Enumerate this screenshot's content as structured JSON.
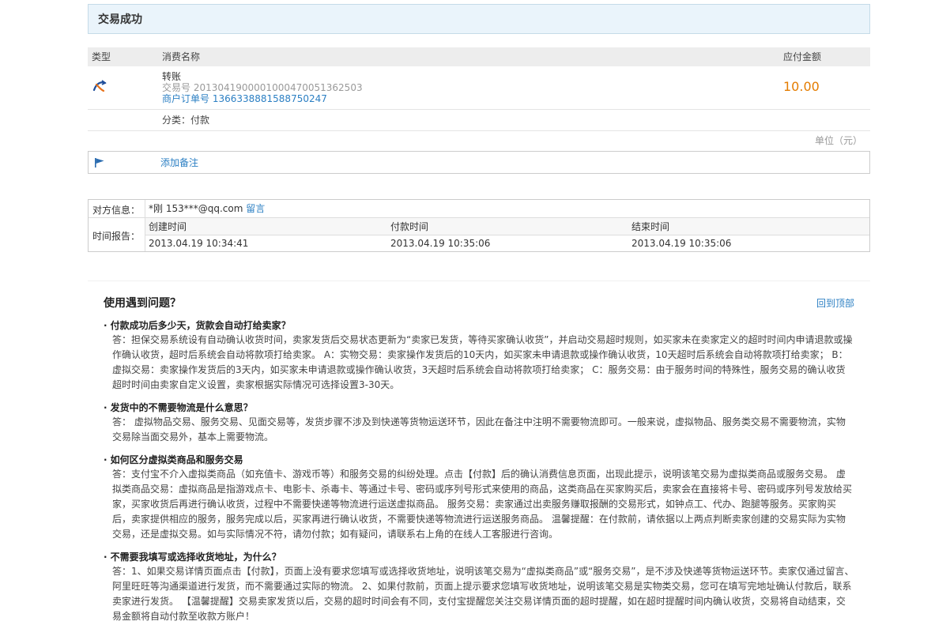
{
  "status": {
    "title": "交易成功"
  },
  "order_table": {
    "headers": {
      "type": "类型",
      "name": "消费名称",
      "amount": "应付金额"
    },
    "row": {
      "icon": "transfer-icon",
      "item_name": "转账",
      "trade_no": "交易号 2013041900001000470051362503",
      "merchant_no": "商户订单号 1366338881588750247",
      "amount": "10.00"
    },
    "category": "分类：付款",
    "unit": "单位（元）"
  },
  "note": {
    "icon": "flag-icon",
    "label": "添加备注"
  },
  "info": {
    "counterparty_label": "对方信息：",
    "counterparty_value": "*刚 153***@qq.com",
    "message_link": "留言",
    "time_label": "时间报告：",
    "time_headers": [
      "创建时间",
      "付款时间",
      "结束时间"
    ],
    "time_values": [
      "2013.04.19 10:34:41",
      "2013.04.19 10:35:06",
      "2013.04.19 10:35:06"
    ]
  },
  "faq": {
    "title": "使用遇到问题？",
    "back_to_top": "回到顶部",
    "items": [
      {
        "q": "付款成功后多少天，货款会自动打给卖家？",
        "a": "答：担保交易系统设有自动确认收货时间，卖家发货后交易状态更新为“卖家已发货，等待买家确认收货”，并启动交易超时规则，如买家未在卖家定义的超时时间内申请退款或操作确认收货，超时后系统会自动将款项打给卖家。 A：实物交易：卖家操作发货后的10天内，如买家未申请退款或操作确认收货，10天超时后系统会自动将款项打给卖家； B：虚拟交易：卖家操作发货后的3天内，如买家未申请退款或操作确认收货，3天超时后系统会自动将款项打给卖家； C：服务交易：由于服务时间的特殊性，服务交易的确认收货超时时间由卖家自定义设置，卖家根据实际情况可选择设置3-30天。"
      },
      {
        "q": "发货中的不需要物流是什么意思？",
        "a": "答： 虚拟物品交易、服务交易、见面交易等，发货步骤不涉及到快递等货物运送环节，因此在备注中注明不需要物流即可。一般来说，虚拟物品、服务类交易不需要物流，实物交易除当面交易外，基本上需要物流。"
      },
      {
        "q": "如何区分虚拟类商品和服务交易",
        "a": "答：支付宝不介入虚拟类商品（如充值卡、游戏币等）和服务交易的纠纷处理。点击【付款】后的确认消费信息页面，出现此提示，说明该笔交易为虚拟类商品或服务交易。 虚拟类商品交易：虚拟商品是指游戏点卡、电影卡、杀毒卡、等通过卡号、密码或序列号形式来使用的商品，这类商品在买家购买后，卖家会在直接将卡号、密码或序列号发放给买家，买家收货后再进行确认收货，过程中不需要快递等物流进行运送虚拟商品。 服务交易：卖家通过出卖服务赚取报酬的交易形式，如钟点工、代办、跑腿等服务。买家购买后，卖家提供相应的服务，服务完成以后，买家再进行确认收货，不需要快递等物流进行运送服务商品。 温馨提醒：在付款前，请依据以上两点判断卖家创建的交易实际为实物交易，还是虚拟交易。如与实际情况不符，请勿付款；如有疑问，请联系右上角的在线人工客服进行咨询。"
      },
      {
        "q": "不需要我填写或选择收货地址，为什么？",
        "a": "答：1、如果交易详情页面点击【付款】，页面上没有要求您填写或选择收货地址，说明该笔交易为“虚拟类商品”或“服务交易”，是不涉及快递等货物运送环节。卖家仅通过留言、阿里旺旺等沟通渠道进行发货，而不需要通过实际的物流。 2、如果付款前，页面上提示要求您填写收货地址，说明该笔交易是实物类交易，您可在填写完地址确认付款后，联系卖家进行发货。 【温馨提醒】交易卖家发货以后，交易的超时时间会有不同，支付宝提醒您关注交易详情页面的超时提醒，如在超时提醒时间内确认收货，交易将自动结束，交易金额将自动付款至收款方账户！"
      }
    ]
  }
}
